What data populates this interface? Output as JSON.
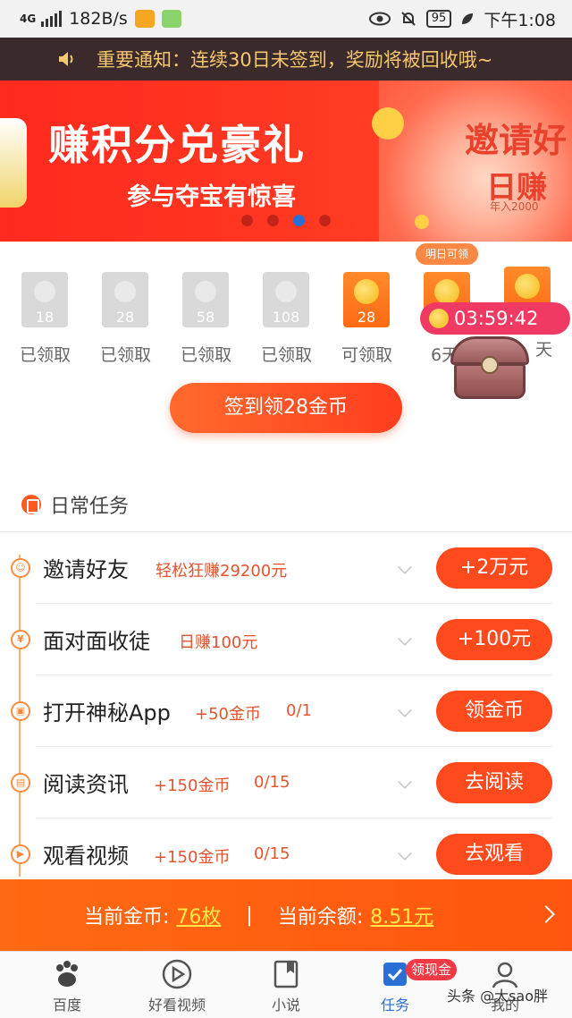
{
  "status_bar": {
    "network": "4G",
    "speed": "182B/s",
    "battery": "95",
    "time": "下午1:08"
  },
  "notice": {
    "text": "重要通知：连续30日未签到，奖励将被回收哦~"
  },
  "banner": {
    "title": "赚积分兑豪礼",
    "subtitle": "参与夺宝有惊喜",
    "next_title": "邀请好",
    "next_subtitle": "日赚",
    "next_small": "年入2000",
    "active_dot": 3
  },
  "checkin": {
    "days": [
      {
        "num": "18",
        "label": "已领取",
        "state": "claimed"
      },
      {
        "num": "28",
        "label": "已领取",
        "state": "claimed"
      },
      {
        "num": "58",
        "label": "已领取",
        "state": "claimed"
      },
      {
        "num": "108",
        "label": "已领取",
        "state": "claimed"
      },
      {
        "num": "28",
        "label": "可领取",
        "state": "available"
      },
      {
        "num": "",
        "label": "6天",
        "state": "future"
      },
      {
        "num": "",
        "label": "天",
        "state": "future"
      }
    ],
    "tomorrow_tag": "明日可领",
    "timer": "03:59:42",
    "sign_button": "签到领28金币"
  },
  "daily_tasks": {
    "title": "日常任务",
    "items": [
      {
        "name": "邀请好友",
        "reward": "轻松狂赚29200元",
        "progress": "",
        "button": "+2万元",
        "icon": "user-icon"
      },
      {
        "name": "面对面收徒",
        "reward": "日赚100元",
        "progress": "",
        "button": "+100元",
        "icon": "yen-icon"
      },
      {
        "name": "打开神秘App",
        "reward": "+50金币",
        "progress": "0/1",
        "button": "领金币",
        "icon": "app-icon"
      },
      {
        "name": "阅读资讯",
        "reward": "+150金币",
        "progress": "0/15",
        "button": "去阅读",
        "icon": "doc-icon"
      },
      {
        "name": "观看视频",
        "reward": "+150金币",
        "progress": "0/15",
        "button": "去观看",
        "icon": "play-icon"
      }
    ]
  },
  "coin_bar": {
    "coins_label": "当前金币:",
    "coins_value": "76枚",
    "separator": "|",
    "balance_label": "当前余额:",
    "balance_value": "8.51元"
  },
  "tab_bar": {
    "tabs": [
      {
        "label": "百度",
        "icon": "baidu-paw-icon"
      },
      {
        "label": "好看视频",
        "icon": "play-icon"
      },
      {
        "label": "小说",
        "icon": "book-icon"
      },
      {
        "label": "任务",
        "icon": "check-task-icon",
        "active": true
      },
      {
        "label": "我的",
        "icon": "user-icon"
      }
    ],
    "badge": "领现金"
  },
  "watermark": "头条 @大sao胖"
}
